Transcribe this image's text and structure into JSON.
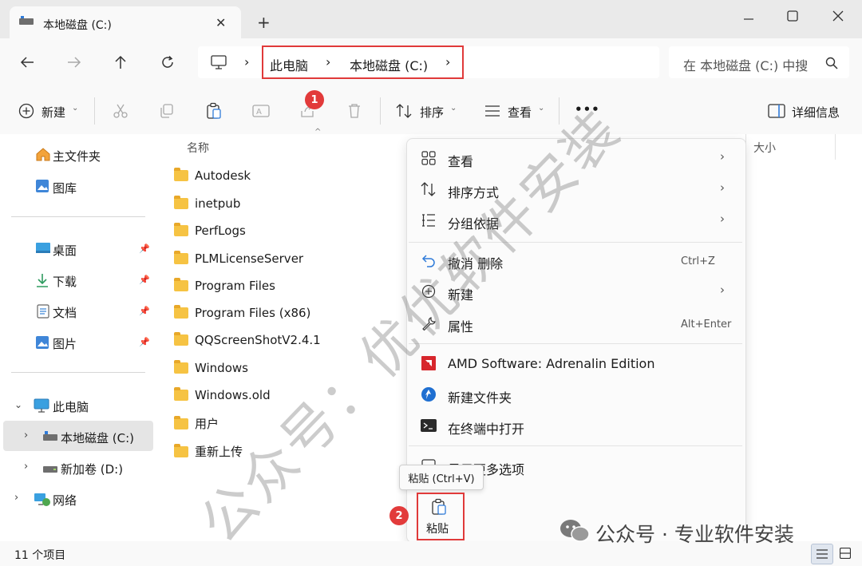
{
  "window": {
    "tab_title": "本地磁盘 (C:)",
    "tab_close": "✕",
    "new_tab": "+"
  },
  "nav": {
    "breadcrumb": [
      "此电脑",
      "本地磁盘 (C:)"
    ],
    "separator": "›",
    "search_placeholder": "在 本地磁盘 (C:) 中搜"
  },
  "toolbar": {
    "new_label": "新建",
    "sort_label": "排序",
    "view_label": "查看",
    "more_label": "•••",
    "details_label": "详细信息",
    "badge1": "1"
  },
  "sidebar": {
    "quick": [
      {
        "label": "主文件夹",
        "icon": "home-icon"
      },
      {
        "label": "图库",
        "icon": "gallery-icon"
      }
    ],
    "pinned": [
      {
        "label": "桌面",
        "icon": "desktop-icon"
      },
      {
        "label": "下载",
        "icon": "download-icon"
      },
      {
        "label": "文档",
        "icon": "document-icon"
      },
      {
        "label": "图片",
        "icon": "pictures-icon"
      }
    ],
    "tree": [
      {
        "label": "此电脑",
        "icon": "computer-icon",
        "expanded": true
      },
      {
        "label": "本地磁盘 (C:)",
        "icon": "drive-icon",
        "selected": true
      },
      {
        "label": "新加卷 (D:)",
        "icon": "drive-icon"
      },
      {
        "label": "网络",
        "icon": "network-icon"
      }
    ]
  },
  "files": {
    "col_name": "名称",
    "col_size": "大小",
    "items": [
      "Autodesk",
      "inetpub",
      "PerfLogs",
      "PLMLicenseServer",
      "Program Files",
      "Program Files (x86)",
      "QQScreenShotV2.4.1",
      "Windows",
      "Windows.old",
      "用户",
      "重新上传"
    ]
  },
  "context_menu": {
    "items": [
      {
        "label": "查看",
        "icon": "grid-icon",
        "submenu": true
      },
      {
        "label": "排序方式",
        "icon": "sort-icon",
        "submenu": true
      },
      {
        "label": "分组依据",
        "icon": "group-icon",
        "submenu": true
      },
      {
        "label": "撤消 删除",
        "icon": "undo-icon",
        "shortcut": "Ctrl+Z"
      },
      {
        "label": "新建",
        "icon": "new-icon",
        "submenu": true
      },
      {
        "label": "属性",
        "icon": "wrench-icon",
        "shortcut": "Alt+Enter"
      },
      {
        "label": "AMD Software: Adrenalin Edition",
        "icon": "amd-icon"
      },
      {
        "label": "新建文件夹",
        "icon": "new-folder-icon"
      },
      {
        "label": "在终端中打开",
        "icon": "terminal-icon"
      },
      {
        "label": "显示更多选项",
        "icon": "more-options-icon"
      }
    ],
    "tooltip": "粘贴 (Ctrl+V)",
    "paste_label": "粘贴",
    "badge2": "2"
  },
  "status": {
    "item_count": "11 个项目"
  },
  "watermark": {
    "diagonal": "公众号：优优软件安装",
    "wechat": "公众号 · 专业软件安装"
  },
  "colors": {
    "accent_red": "#e03a3a",
    "folder_yellow": "#f6c343",
    "selection": "#e5e5e5"
  }
}
